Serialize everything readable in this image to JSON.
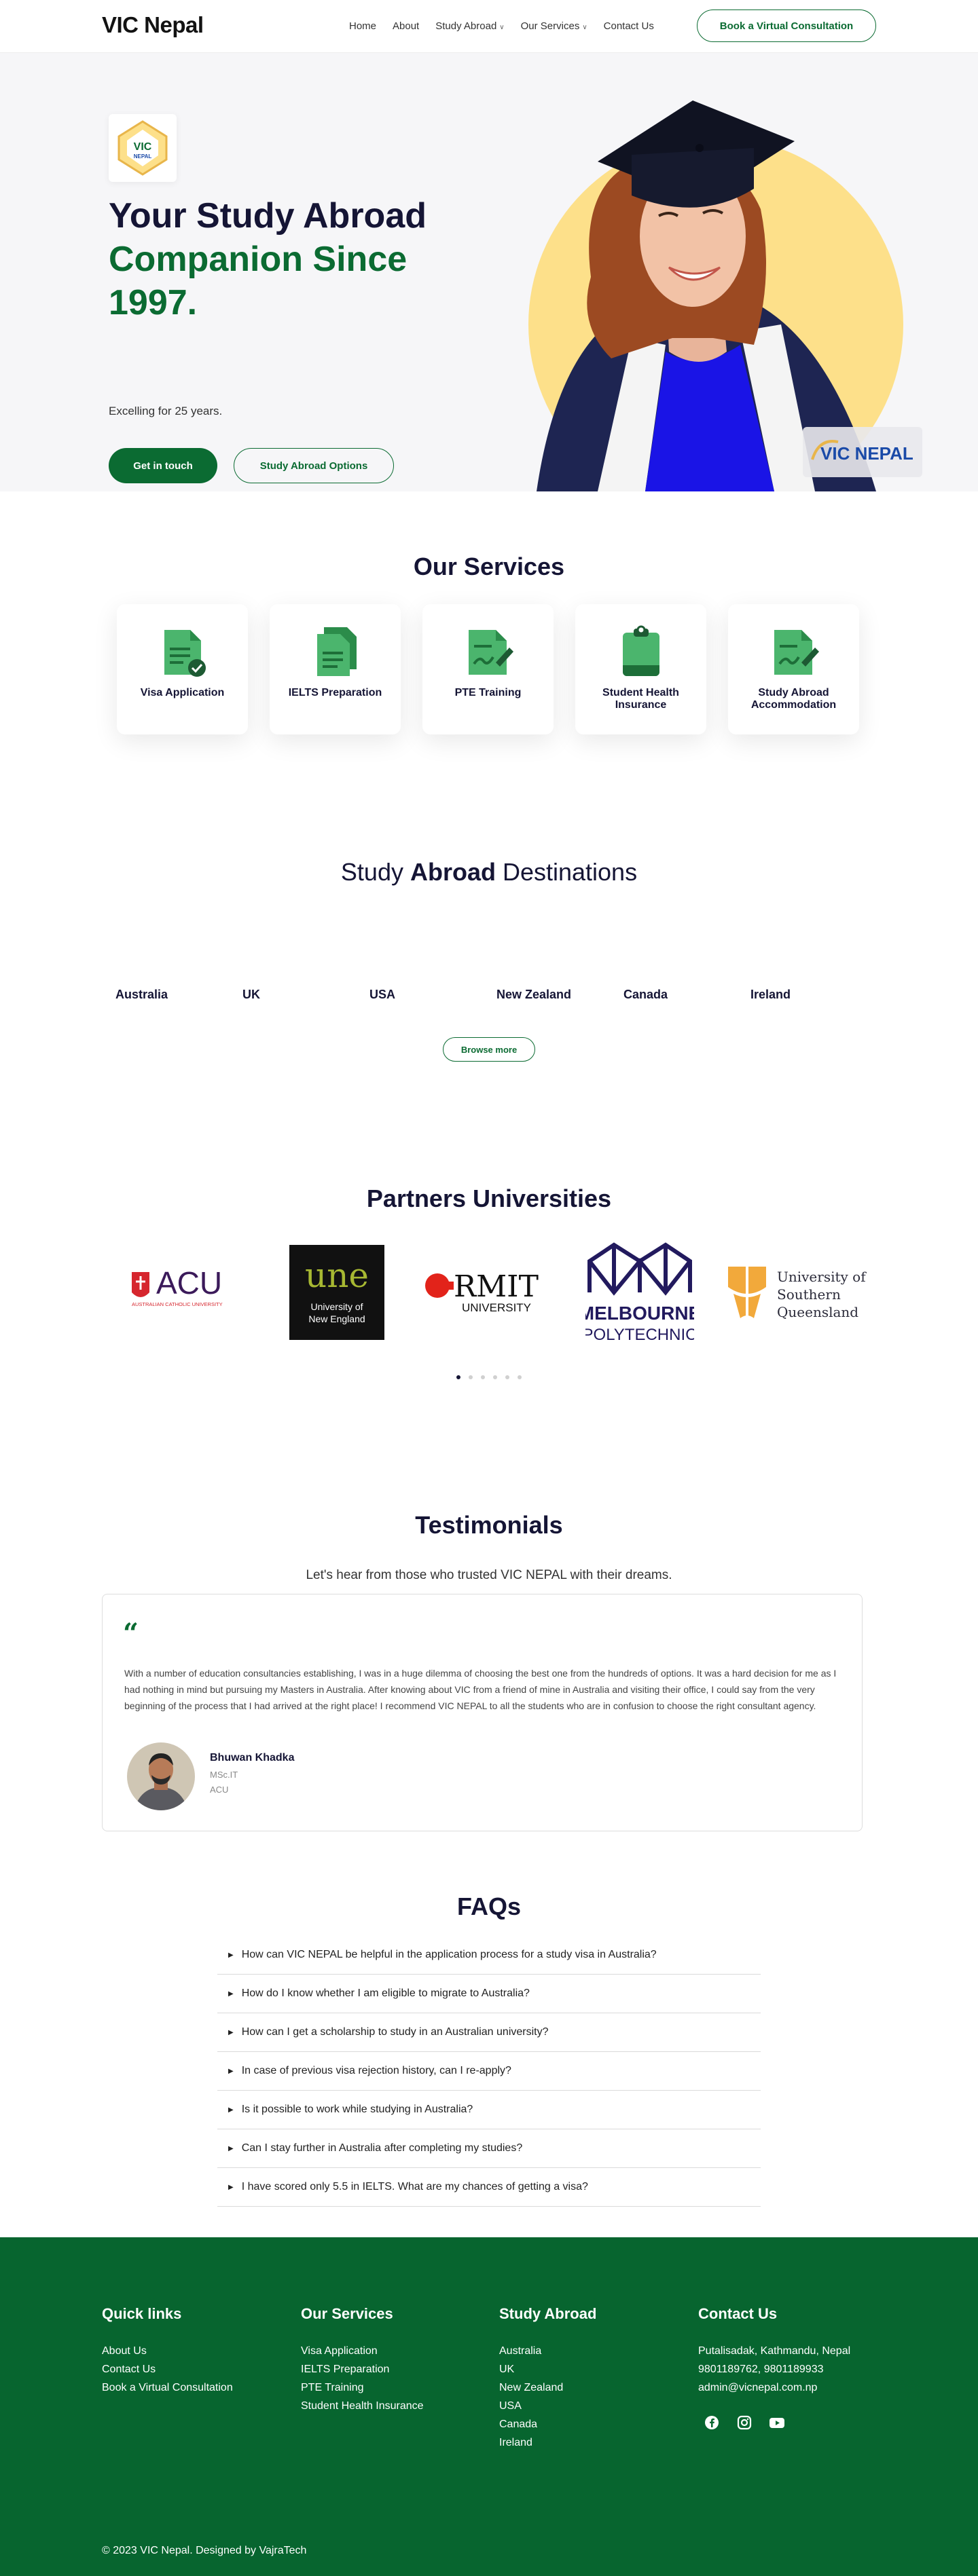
{
  "header": {
    "logo": "VIC Nepal",
    "nav": [
      {
        "label": "Home"
      },
      {
        "label": "About"
      },
      {
        "label": "Study Abroad",
        "dropdown": true
      },
      {
        "label": "Our Services",
        "dropdown": true
      },
      {
        "label": "Contact Us"
      }
    ],
    "cta": "Book a Virtual Consultation"
  },
  "hero": {
    "badge_text": "VIC",
    "badge_sub": "NEPAL",
    "title_line1": "Your Study Abroad",
    "title_line2": "Companion Since",
    "title_line3": "1997.",
    "subtitle": "Excelling for 25 years.",
    "btn_primary": "Get in touch",
    "btn_secondary": "Study Abroad Options",
    "image_chip": "VIC NEPAL"
  },
  "services": {
    "title": "Our Services",
    "items": [
      {
        "label": "Visa Application",
        "icon": "visa-document-check-icon"
      },
      {
        "label": "IELTS Preparation",
        "icon": "stacked-documents-icon"
      },
      {
        "label": "PTE Training",
        "icon": "document-pen-icon"
      },
      {
        "label": "Student Health Insurance",
        "icon": "clipboard-icon"
      },
      {
        "label": "Study Abroad Accommodation",
        "icon": "document-pen-icon"
      }
    ]
  },
  "destinations": {
    "title_pre": "Study ",
    "title_bold": "Abroad",
    "title_post": " Destinations",
    "items": [
      "Australia",
      "UK",
      "USA",
      "New Zealand",
      "Canada",
      "Ireland"
    ],
    "browse": "Browse more"
  },
  "partners": {
    "title": "Partners Universities",
    "acu": {
      "name": "ACU",
      "sub": "AUSTRALIAN CATHOLIC UNIVERSITY"
    },
    "une": {
      "name": "une",
      "sub1": "University of",
      "sub2": "New England"
    },
    "rmit": {
      "name": "RMIT",
      "sub": "UNIVERSITY"
    },
    "melbourne": {
      "name1": "MELBOURNE",
      "name2": "POLYTECHNIC"
    },
    "usq": {
      "line1": "University of",
      "line2": "Southern",
      "line3": "Queensland"
    },
    "slide_count": 6,
    "active_slide": 1
  },
  "testimonials": {
    "title": "Testimonials",
    "subtitle": "Let's hear from those who trusted VIC NEPAL with their dreams.",
    "quote_mark": "“",
    "text": "With a number of education consultancies establishing, I was in a huge dilemma of choosing the best one from the hundreds of options. It was a hard decision for me as I had nothing in mind but pursuing my Masters in Australia. After knowing about VIC from a friend of mine in Australia and visiting their office, I could say from the very beginning of the process that I had arrived at the right place! I recommend VIC NEPAL to all the students who are in confusion to choose the right consultant agency.",
    "name": "Bhuwan Khadka",
    "course": "MSc.IT",
    "university": "ACU"
  },
  "faqs": {
    "title": "FAQs",
    "items": [
      "How can VIC NEPAL be helpful in the application process for a study visa in Australia?",
      "How do I know whether I am eligible to migrate to Australia?",
      "How can I get a scholarship to study in an Australian university?",
      "In case of previous visa rejection history, can I re-apply?",
      "Is it possible to work while studying in Australia?",
      "Can I stay further in Australia after completing my studies?",
      "I have scored only 5.5 in IELTS. What are my chances of getting a visa?"
    ]
  },
  "footer": {
    "quick_links": {
      "title": "Quick links",
      "items": [
        "About Us",
        "Contact Us",
        "Book a Virtual Consultation"
      ]
    },
    "our_services": {
      "title": "Our Services",
      "items": [
        "Visa Application",
        "IELTS Preparation",
        "PTE Training",
        "Student Health Insurance"
      ]
    },
    "study_abroad": {
      "title": "Study Abroad",
      "items": [
        "Australia",
        "UK",
        "New Zealand",
        "USA",
        "Canada",
        "Ireland"
      ]
    },
    "contact": {
      "title": "Contact Us",
      "address": "Putalisadak, Kathmandu, Nepal",
      "phone": "9801189762, 9801189933",
      "email": "admin@vicnepal.com.np",
      "social": [
        "facebook-icon",
        "instagram-icon",
        "youtube-icon"
      ]
    },
    "copyright": "© 2023 VIC Nepal. Designed by VajraTech"
  },
  "colors": {
    "brand_green": "#0b6b32",
    "footer_green": "#07652f",
    "navy": "#151535",
    "hero_circle": "#fde08a"
  }
}
